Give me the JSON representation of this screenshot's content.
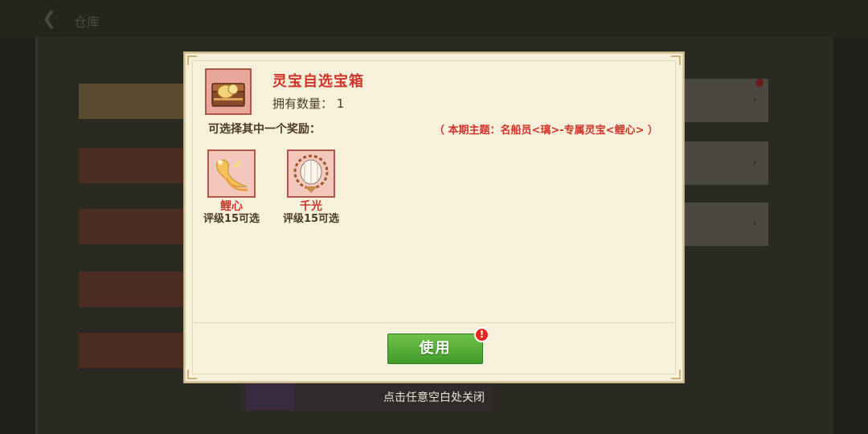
{
  "background": {
    "title": "仓库"
  },
  "dialog": {
    "item_name": "灵宝自选宝箱",
    "owned_label": "拥有数量：",
    "owned_count": "1",
    "choose_prompt": "可选择其中一个奖励：",
    "theme_note": "（ 本期主题：名船员<璃>-专属灵宝<鲤心> ）",
    "rewards": [
      {
        "name": "鲤心",
        "condition": "评级15可选",
        "icon": "koi-charm-icon"
      },
      {
        "name": "千光",
        "condition": "评级15可选",
        "icon": "lantern-icon"
      }
    ],
    "use_button": "使用",
    "alert_badge": "!"
  },
  "close_hint": "点击任意空白处关闭",
  "colors": {
    "accent_red": "#d0342a",
    "button_green": "#4ead34",
    "dialog_bg": "#f7f1dc",
    "text_brown": "#4a3a26"
  }
}
